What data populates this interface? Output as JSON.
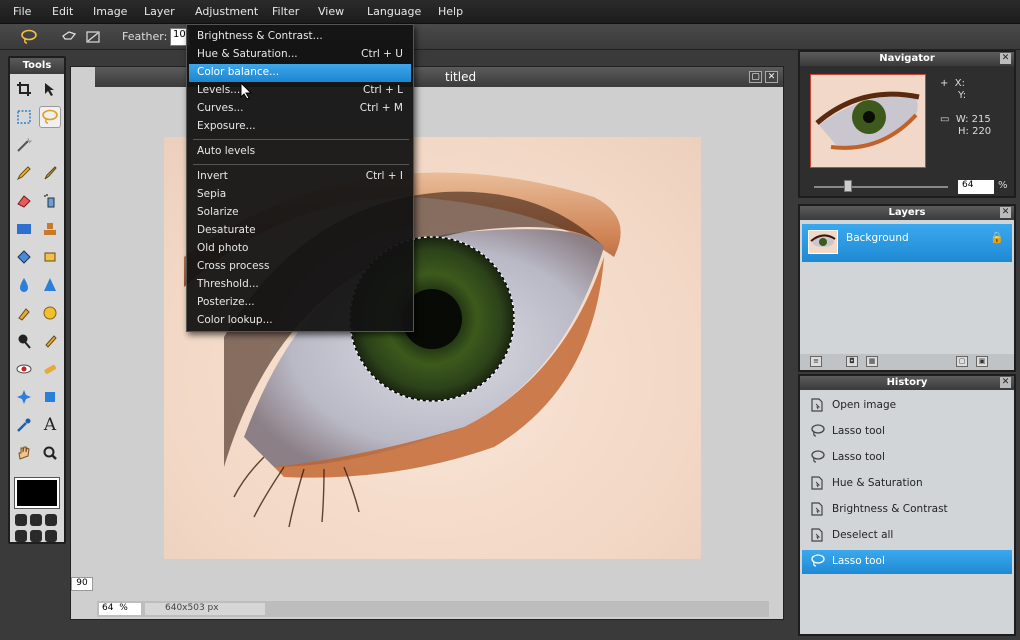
{
  "menu": [
    "File",
    "Edit",
    "Image",
    "Layer",
    "Adjustment",
    "Filter",
    "View",
    "Language",
    "Help"
  ],
  "options": {
    "feather_label": "Feather:",
    "feather_value": "10"
  },
  "tools_panel": {
    "title": "Tools"
  },
  "document": {
    "title": "titled",
    "zoom": "64",
    "zoom_unit": "%",
    "dimensions": "640x503 px",
    "side_readout": "90"
  },
  "adjustment_menu": [
    {
      "label": "Brightness & Contrast...",
      "shortcut": ""
    },
    {
      "label": "Hue & Saturation...",
      "shortcut": "Ctrl + U"
    },
    {
      "label": "Color balance...",
      "shortcut": ""
    },
    {
      "label": "Levels...",
      "shortcut": "Ctrl + L"
    },
    {
      "label": "Curves...",
      "shortcut": "Ctrl + M"
    },
    {
      "label": "Exposure...",
      "shortcut": ""
    },
    {
      "label": "Auto levels",
      "shortcut": ""
    },
    {
      "label": "Invert",
      "shortcut": "Ctrl + I"
    },
    {
      "label": "Sepia",
      "shortcut": ""
    },
    {
      "label": "Solarize",
      "shortcut": ""
    },
    {
      "label": "Desaturate",
      "shortcut": ""
    },
    {
      "label": "Old photo",
      "shortcut": ""
    },
    {
      "label": "Cross process",
      "shortcut": ""
    },
    {
      "label": "Threshold...",
      "shortcut": ""
    },
    {
      "label": "Posterize...",
      "shortcut": ""
    },
    {
      "label": "Color lookup...",
      "shortcut": ""
    }
  ],
  "navigator": {
    "title": "Navigator",
    "x_label": "X:",
    "y_label": "Y:",
    "w_label": "W:",
    "w_value": "215",
    "h_label": "H:",
    "h_value": "220",
    "zoom": "64",
    "zoom_unit": "%"
  },
  "layers": {
    "title": "Layers",
    "items": [
      {
        "name": "Background"
      }
    ]
  },
  "history": {
    "title": "History",
    "items": [
      {
        "label": "Open image",
        "icon": "document-icon"
      },
      {
        "label": "Lasso tool",
        "icon": "lasso-icon"
      },
      {
        "label": "Lasso tool",
        "icon": "lasso-icon"
      },
      {
        "label": "Hue & Saturation",
        "icon": "document-icon"
      },
      {
        "label": "Brightness & Contrast",
        "icon": "document-icon"
      },
      {
        "label": "Deselect all",
        "icon": "document-icon"
      },
      {
        "label": "Lasso tool",
        "icon": "lasso-icon"
      }
    ],
    "selected_index": 6
  },
  "colors": {
    "highlight": "#1e8ad4",
    "primary_swatch": "#000000"
  }
}
